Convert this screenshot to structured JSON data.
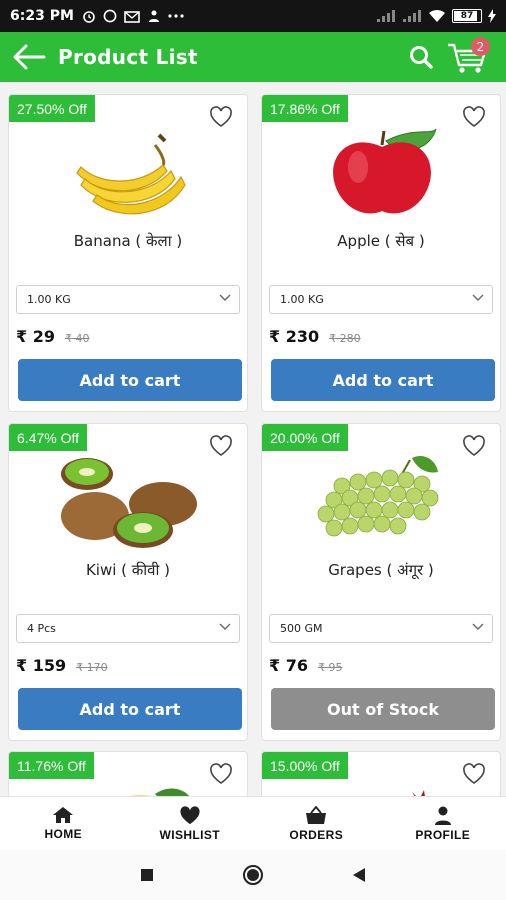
{
  "status_bar": {
    "time": "6:23 PM",
    "battery": "87"
  },
  "app_bar": {
    "title": "Product List",
    "cart_count": "2"
  },
  "products": [
    {
      "discount": "27.50% Off",
      "name": "Banana ( केला )",
      "variant": "1.00 KG",
      "price": "₹ 29",
      "mrp": "₹ 40",
      "action": "Add to cart",
      "in_stock": true,
      "image": "banana"
    },
    {
      "discount": "17.86% Off",
      "name": "Apple ( सेब )",
      "variant": "1.00 KG",
      "price": "₹ 230",
      "mrp": "₹ 280",
      "action": "Add to cart",
      "in_stock": true,
      "image": "apple"
    },
    {
      "discount": "6.47% Off",
      "name": "Kiwi ( कीवी )",
      "variant": "4 Pcs",
      "price": "₹ 159",
      "mrp": "₹ 170",
      "action": "Add to cart",
      "in_stock": true,
      "image": "kiwi"
    },
    {
      "discount": "20.00% Off",
      "name": "Grapes ( अंगूर )",
      "variant": "500 GM",
      "price": "₹ 76",
      "mrp": "₹ 95",
      "action": "Out of Stock",
      "in_stock": false,
      "image": "grapes"
    },
    {
      "discount": "11.76% Off",
      "image": "mango"
    },
    {
      "discount": "15.00% Off",
      "image": "pomegranate"
    }
  ],
  "bottom_nav": [
    {
      "label": "HOME",
      "icon": "home-icon"
    },
    {
      "label": "WISHLIST",
      "icon": "heart-icon"
    },
    {
      "label": "ORDERS",
      "icon": "basket-icon"
    },
    {
      "label": "PROFILE",
      "icon": "person-icon"
    }
  ],
  "colors": {
    "primary": "#2ebd38",
    "cta": "#3a7cc1",
    "out_of_stock": "#8e8e8e",
    "badge": "#e25a63"
  }
}
